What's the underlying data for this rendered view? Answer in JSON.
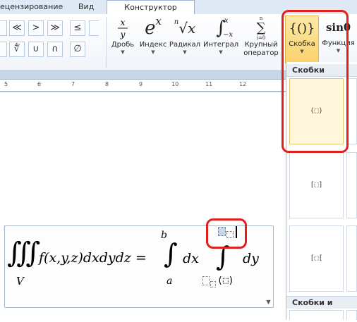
{
  "tabs": {
    "review": "ецензирование",
    "view": "Вид",
    "constructor": "Конструктор"
  },
  "symbols": {
    "row1": [
      "|",
      "≪",
      ">",
      "≫",
      "≤"
    ],
    "row2": [
      "|",
      "∜",
      "∪",
      "∩",
      "∅"
    ]
  },
  "buttons": {
    "fraction": {
      "label": "Дробь"
    },
    "index": {
      "label": "Индекс",
      "glyph": "e",
      "sup": "x"
    },
    "radical": {
      "label": "Радикал",
      "glyph_n": "n",
      "glyph": "√x"
    },
    "integral": {
      "label": "Интеграл",
      "glyph": "∫",
      "top": "x",
      "bottom": "−x"
    },
    "large_operator": {
      "label": "Крупный оператор",
      "glyph": "∑"
    },
    "bracket": {
      "label": "Скобка",
      "glyph": "{()}"
    },
    "function": {
      "label": "Функция",
      "glyph": "sinθ"
    }
  },
  "ruler": {
    "ticks": [
      "5",
      "6",
      "7",
      "8",
      "9",
      "10",
      "11",
      "12"
    ]
  },
  "equation": {
    "triple_integral": "∭",
    "lower_V": "V",
    "integrand": "f(x,y,z)dxdydz =",
    "single_integral": "∫",
    "upper_b": "b",
    "lower_a": "a",
    "dx": "dx",
    "inner_integral": "∫",
    "dy": "dy",
    "paren_placeholder": "(⬚)"
  },
  "panel": {
    "header_brackets": "Скобки",
    "header_brackets_sep": "Скобки и раздел",
    "items": [
      "(⬚)",
      "[⬚]",
      "[⬚["
    ]
  },
  "colors": {
    "highlight": "#e0201c",
    "active_button": "#f9d26b",
    "ribbon": "#dfe9f5"
  }
}
